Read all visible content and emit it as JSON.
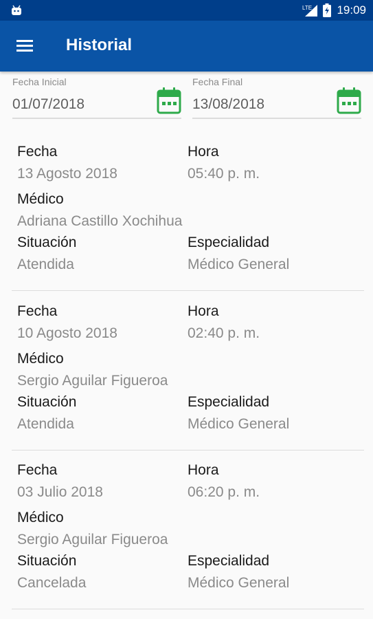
{
  "status_bar": {
    "time": "19:09",
    "network": "LTE",
    "colors": {
      "background": "#003e8a"
    }
  },
  "app_bar": {
    "title": "Historial",
    "menu_icon": "hamburger-menu-icon",
    "colors": {
      "background": "#0a54a6",
      "text": "#ffffff"
    }
  },
  "filters": {
    "start": {
      "label": "Fecha Inicial",
      "value": "01/07/2018",
      "icon": "calendar-icon"
    },
    "end": {
      "label": "Fecha Final",
      "value": "13/08/2018",
      "icon": "calendar-icon"
    },
    "calendar_color": "#2eaa4a"
  },
  "labels": {
    "date": "Fecha",
    "time": "Hora",
    "doctor": "Médico",
    "status": "Situación",
    "specialty": "Especialidad"
  },
  "records": [
    {
      "date": "13 Agosto 2018",
      "time": "05:40 p. m.",
      "doctor": "Adriana Castillo Xochihua",
      "status": "Atendida",
      "specialty": "Médico General"
    },
    {
      "date": "10 Agosto 2018",
      "time": "02:40 p. m.",
      "doctor": "Sergio Aguilar Figueroa",
      "status": "Atendida",
      "specialty": "Médico General"
    },
    {
      "date": "03 Julio 2018",
      "time": "06:20 p. m.",
      "doctor": "Sergio Aguilar Figueroa",
      "status": "Cancelada",
      "specialty": "Médico General"
    }
  ]
}
